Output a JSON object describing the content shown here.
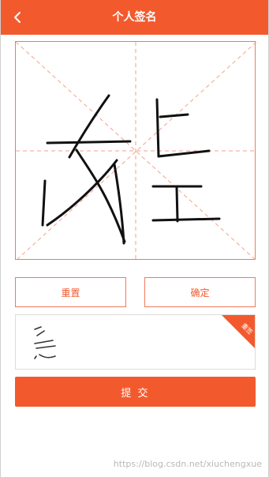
{
  "header": {
    "title": "个人签名",
    "back_icon": "chevron-left-icon",
    "background": "#f25a2e"
  },
  "signature_pad": {
    "border_color": "#f07a5c",
    "guide_color": "#f3a28b"
  },
  "actions": {
    "reset_label": "重置",
    "confirm_label": "确定"
  },
  "preview": {
    "badge_label": "重签",
    "badge_color": "#f25a2e"
  },
  "submit": {
    "label": "提 交"
  },
  "watermark": {
    "text": "https://blog.csdn.net/xiuchengxue"
  }
}
